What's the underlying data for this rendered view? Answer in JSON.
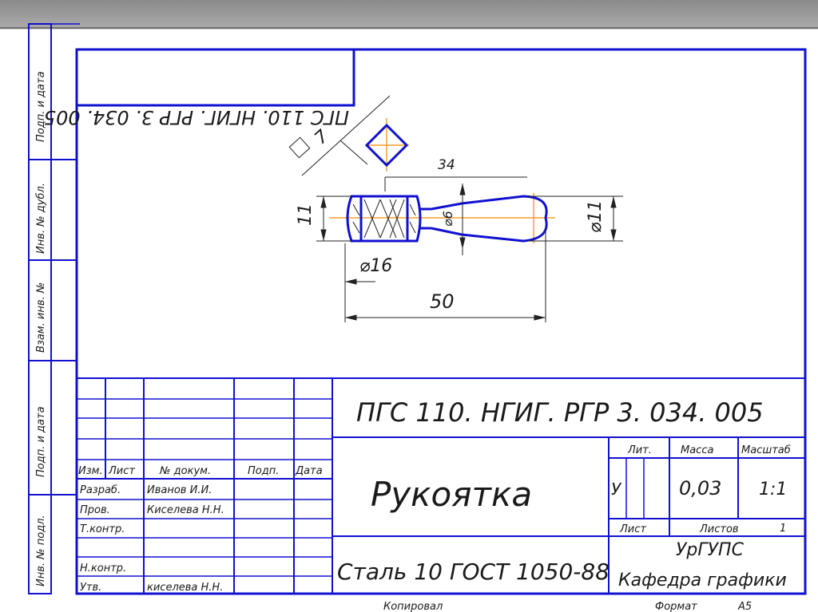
{
  "drawing": {
    "code_mirrored": "ПГС 110. НГИГ. РГР 3. 034. 005",
    "code": "ПГС 110. НГИГ. РГР 3. 034. 005",
    "part_name": "Рукоятка",
    "material": "Сталь 10  ГОСТ 1050-88",
    "organization_line1": "УрГУПС",
    "organization_line2": "Кафедра графики",
    "copied_label": "Копировал",
    "format_label": "Формат",
    "format_value": "А5"
  },
  "dimensions": {
    "square": "7",
    "length_34": "34",
    "length_50": "50",
    "height_11": "11",
    "dia_16": "⌀16",
    "dia_11": "⌀11",
    "dia_6": "⌀6"
  },
  "title_block": {
    "lit_header": "Лит.",
    "mass_header": "Масса",
    "scale_header": "Масштаб",
    "lit_value": "У",
    "mass_value": "0,03",
    "scale_value": "1:1",
    "sheet_label": "Лист",
    "sheets_label": "Листов",
    "sheets_value": "1",
    "col_izm": "Изм.",
    "col_list": "Лист",
    "col_doc": "№ докум.",
    "col_sign": "Подп.",
    "col_date": "Дата",
    "role_develop": "Разраб.",
    "role_check": "Пров.",
    "role_tcontrol": "Т.контр.",
    "role_ncontrol": "Н.контр.",
    "role_approve": "Утв.",
    "name_develop": "Иванов И.И.",
    "name_check": "Киселева Н.Н.",
    "name_approve": "киселева Н.Н."
  },
  "side_labels": {
    "sign_date_top": "Подп. и дата",
    "dup_inv": "Инв. № дубл.",
    "replace_inv": "Взам. инв. №",
    "sign_date_bottom": "Подп. и дата",
    "orig_inv": "Инв. № подл."
  },
  "colors": {
    "frame": "#1010d0",
    "axis": "#f08a00",
    "title_bar": "#9a9a9a"
  }
}
